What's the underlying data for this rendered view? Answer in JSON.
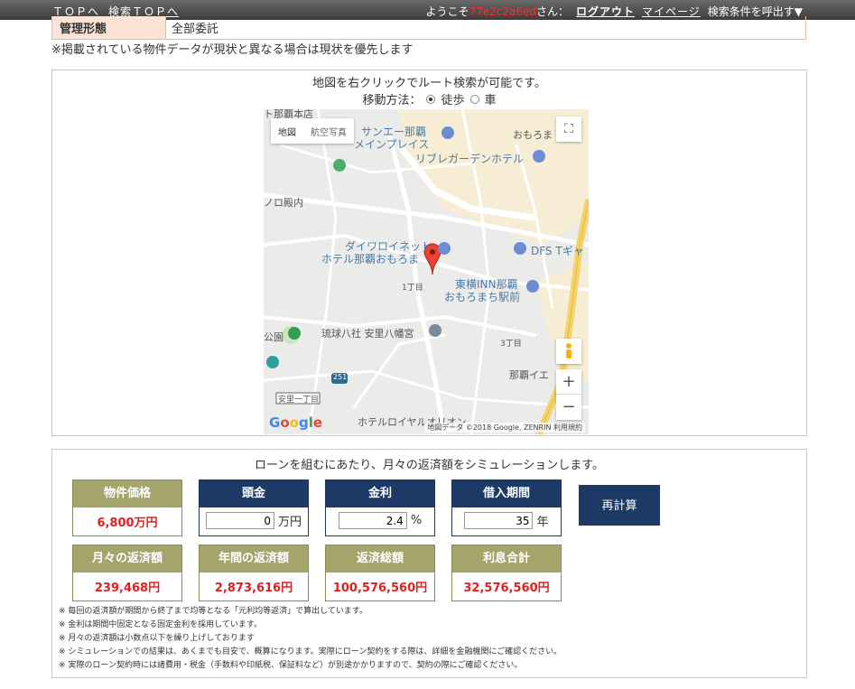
{
  "topbar": {
    "top_link": "ＴＯＰへ",
    "search_top_link": "検索ＴＯＰへ",
    "welcome_prefix": "ようこそ",
    "user_id": "77e2c2a6ed",
    "welcome_suffix": "さん：",
    "logout": "ログアウト",
    "mypage": "マイページ",
    "recall_search": "検索条件を呼出す▼"
  },
  "property": {
    "mgmt_label": "管理形態",
    "mgmt_value": "全部委託",
    "notice": "※掲載されている物件データが現状と異なる場合は現状を優先します"
  },
  "map": {
    "caption": "地図を右クリックでルート検索が可能です。",
    "move_label": "移動方法：",
    "options": [
      "徒歩",
      "車"
    ],
    "selected": "徒歩",
    "type_buttons": [
      "地図",
      "航空写真"
    ],
    "labels": {
      "sanei": "サンエー那覇",
      "sanei2": "メインプレイス",
      "omoro": "おもろま",
      "ribure": "リブレガーデンホテル",
      "noro": "ノロ殿内",
      "daiwa1": "ダイワロイネット",
      "daiwa2": "ホテル那覇おもろま",
      "dfs": "DFS Tギャ",
      "toyoko1": "東横INN那覇",
      "toyoko2": "おもろまち駅前",
      "chome1": "1丁目",
      "park": "公園",
      "ryukyu": "琉球八社 安里八幡宮",
      "chome3": "3丁目",
      "nahai": "那覇イエ",
      "asato": "安里一丁目",
      "route": "251",
      "hotel": "ホテルロイヤルオリオン",
      "top_label": "ト那覇本店"
    },
    "google": "Google",
    "attribution": "地図データ ©2018 Google, ZENRIN 利用規約",
    "zoom_in": "+",
    "zoom_out": "−"
  },
  "loan": {
    "caption": "ローンを組むにあたり、月々の返済額をシミュレーションします。",
    "price_label": "物件価格",
    "price_value": "6,800万円",
    "down_label": "頭金",
    "down_value": "0",
    "down_unit": "万円",
    "rate_label": "金利",
    "rate_value": "2.4",
    "rate_unit": "%",
    "period_label": "借入期間",
    "period_value": "35",
    "period_unit": "年",
    "recalc": "再計算",
    "monthly_label": "月々の返済額",
    "monthly_value": "239,468円",
    "yearly_label": "年間の返済額",
    "yearly_value": "2,873,616円",
    "total_label": "返済総額",
    "total_value": "100,576,560円",
    "interest_label": "利息合計",
    "interest_value": "32,576,560円",
    "notes": [
      "※ 毎回の返済額が期間から終了まで均等となる「元利均等返済」で算出しています。",
      "※ 金利は期間中固定となる固定金利を採用しています。",
      "※ 月々の返済額は小数点以下を繰り上げしております",
      "※ シミュレーションでの結果は、あくまでも目安で、概算になります。実際にローン契約をする際は、詳細を金融機関にご確認ください。",
      "※ 実際のローン契約時には諸費用・税金（手数料や印紙税、保証料など）が別途かかりますので、契約の際にご確認ください。"
    ]
  },
  "colors": {
    "olive": "#a5a46b",
    "navy": "#1d3a66",
    "value_red": "#e0201f",
    "user_red": "#ff2b2b"
  }
}
